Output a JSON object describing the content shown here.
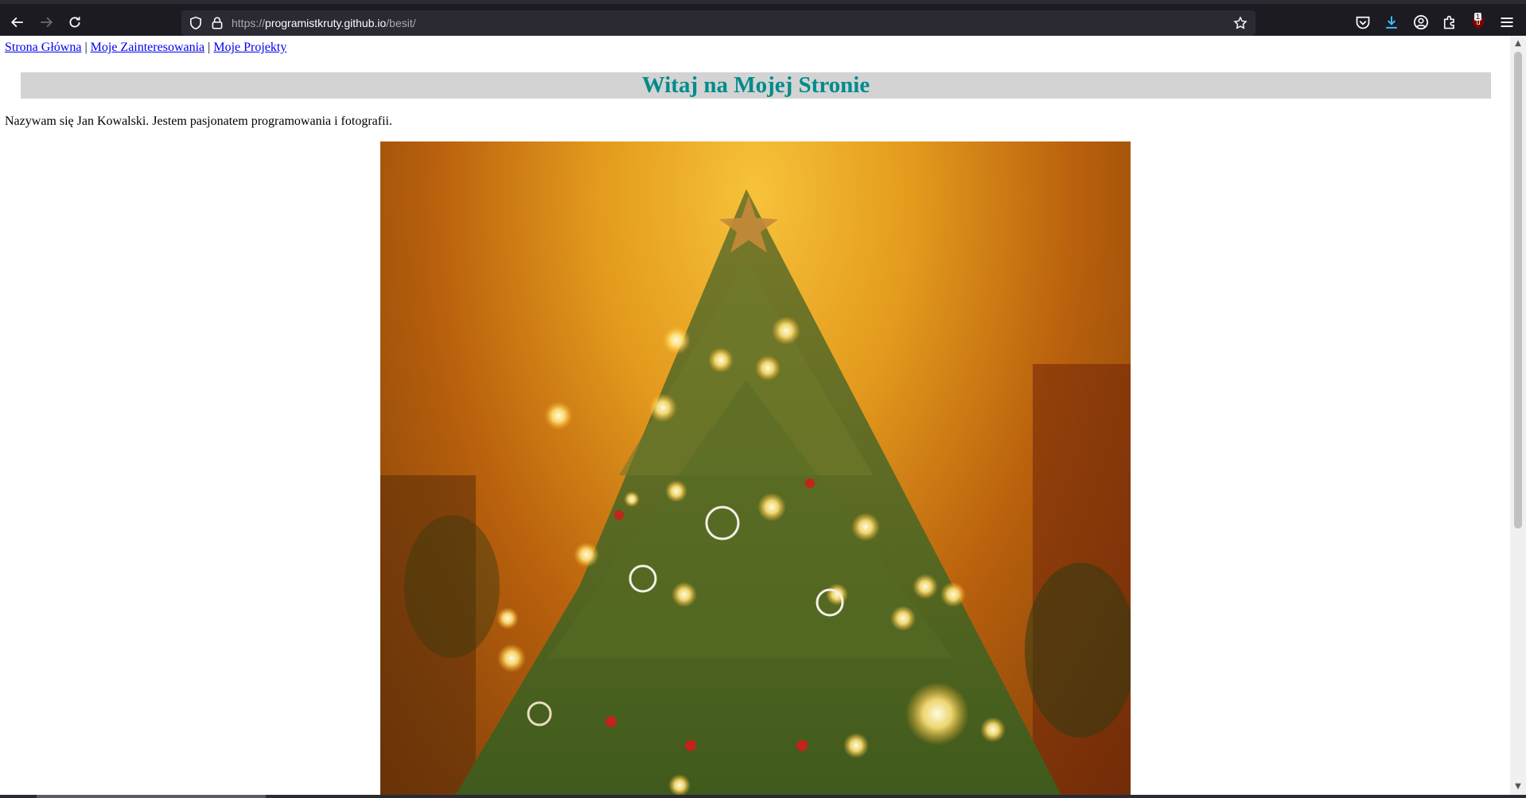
{
  "browser": {
    "url_scheme": "https://",
    "url_host": "programistkruty.github.io",
    "url_path": "/besit/",
    "extension_badge_count": "1"
  },
  "nav": {
    "links": [
      "Strona Główna",
      "Moje Zainteresowania",
      "Moje Projekty"
    ],
    "separator": " | "
  },
  "header": {
    "title": "Witaj na Mojej Stronie"
  },
  "intro": {
    "text": "Nazywam się Jan Kowalski. Jestem pasjonatem programowania i fotografii."
  },
  "image": {
    "subject": "christmas-tree-photo"
  },
  "colors": {
    "header_bg": "#d3d3d3",
    "header_text": "#008b8b",
    "link": "#0000ee",
    "browser_chrome": "#1c1b22"
  }
}
